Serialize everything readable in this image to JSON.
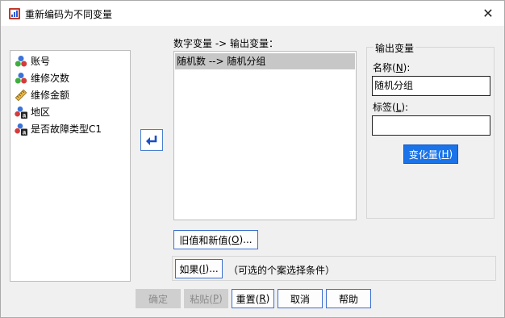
{
  "window": {
    "title": "重新编码为不同变量",
    "close_glyph": "✕"
  },
  "source_list": {
    "items": [
      {
        "label": "账号",
        "icon": "nominal-variable-icon"
      },
      {
        "label": "维修次数",
        "icon": "nominal-variable-icon"
      },
      {
        "label": "维修金额",
        "icon": "scale-variable-icon"
      },
      {
        "label": "地区",
        "icon": "nominal-string-variable-icon"
      },
      {
        "label": "是否故障类型C1",
        "icon": "nominal-string-variable-icon"
      }
    ]
  },
  "mapping": {
    "label": "数字变量 -> 输出变量：",
    "items": [
      "随机数 --> 随机分组"
    ]
  },
  "output": {
    "group_title": "输出变量",
    "name_label": "名称(N):",
    "name_value": "随机分组",
    "tag_label": "标签(L):",
    "tag_value": "",
    "change_button": "变化量(H)"
  },
  "buttons": {
    "old_new": "旧值和新值(O)...",
    "if": "如果(I)...",
    "if_note": "（可选的个案选择条件）",
    "ok": "确定",
    "paste": "粘贴(P)",
    "reset": "重置(R)",
    "cancel": "取消",
    "help": "帮助"
  },
  "colors": {
    "accent": "#1a73e8",
    "button_border": "#3c6fcf",
    "selected_row": "#c7c7c7",
    "disabled_bg": "#cfcfcf"
  }
}
